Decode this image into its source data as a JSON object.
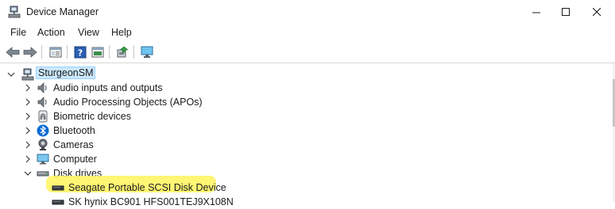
{
  "window": {
    "title": "Device Manager"
  },
  "menu": {
    "file": "File",
    "action": "Action",
    "view": "View",
    "help": "Help"
  },
  "tree": {
    "root": "SturgeonSM",
    "categories": [
      {
        "label": "Audio inputs and outputs",
        "icon": "speaker-icon",
        "expanded": false
      },
      {
        "label": "Audio Processing Objects (APOs)",
        "icon": "speaker-icon",
        "expanded": false
      },
      {
        "label": "Biometric devices",
        "icon": "fingerprint-icon",
        "expanded": false
      },
      {
        "label": "Bluetooth",
        "icon": "bluetooth-icon",
        "expanded": false
      },
      {
        "label": "Cameras",
        "icon": "camera-icon",
        "expanded": false
      },
      {
        "label": "Computer",
        "icon": "monitor-icon",
        "expanded": false
      },
      {
        "label": "Disk drives",
        "icon": "disk-drive-icon",
        "expanded": true
      }
    ],
    "disk_devices": [
      {
        "label": "Seagate Portable SCSI Disk Device",
        "highlighted": true
      },
      {
        "label": "SK hynix BC901 HFS001TEJ9X108N",
        "highlighted": false
      }
    ]
  },
  "colors": {
    "highlight": "#fff45c",
    "selection": "#cce8ff",
    "bluetooth": "#0a6cd6"
  }
}
